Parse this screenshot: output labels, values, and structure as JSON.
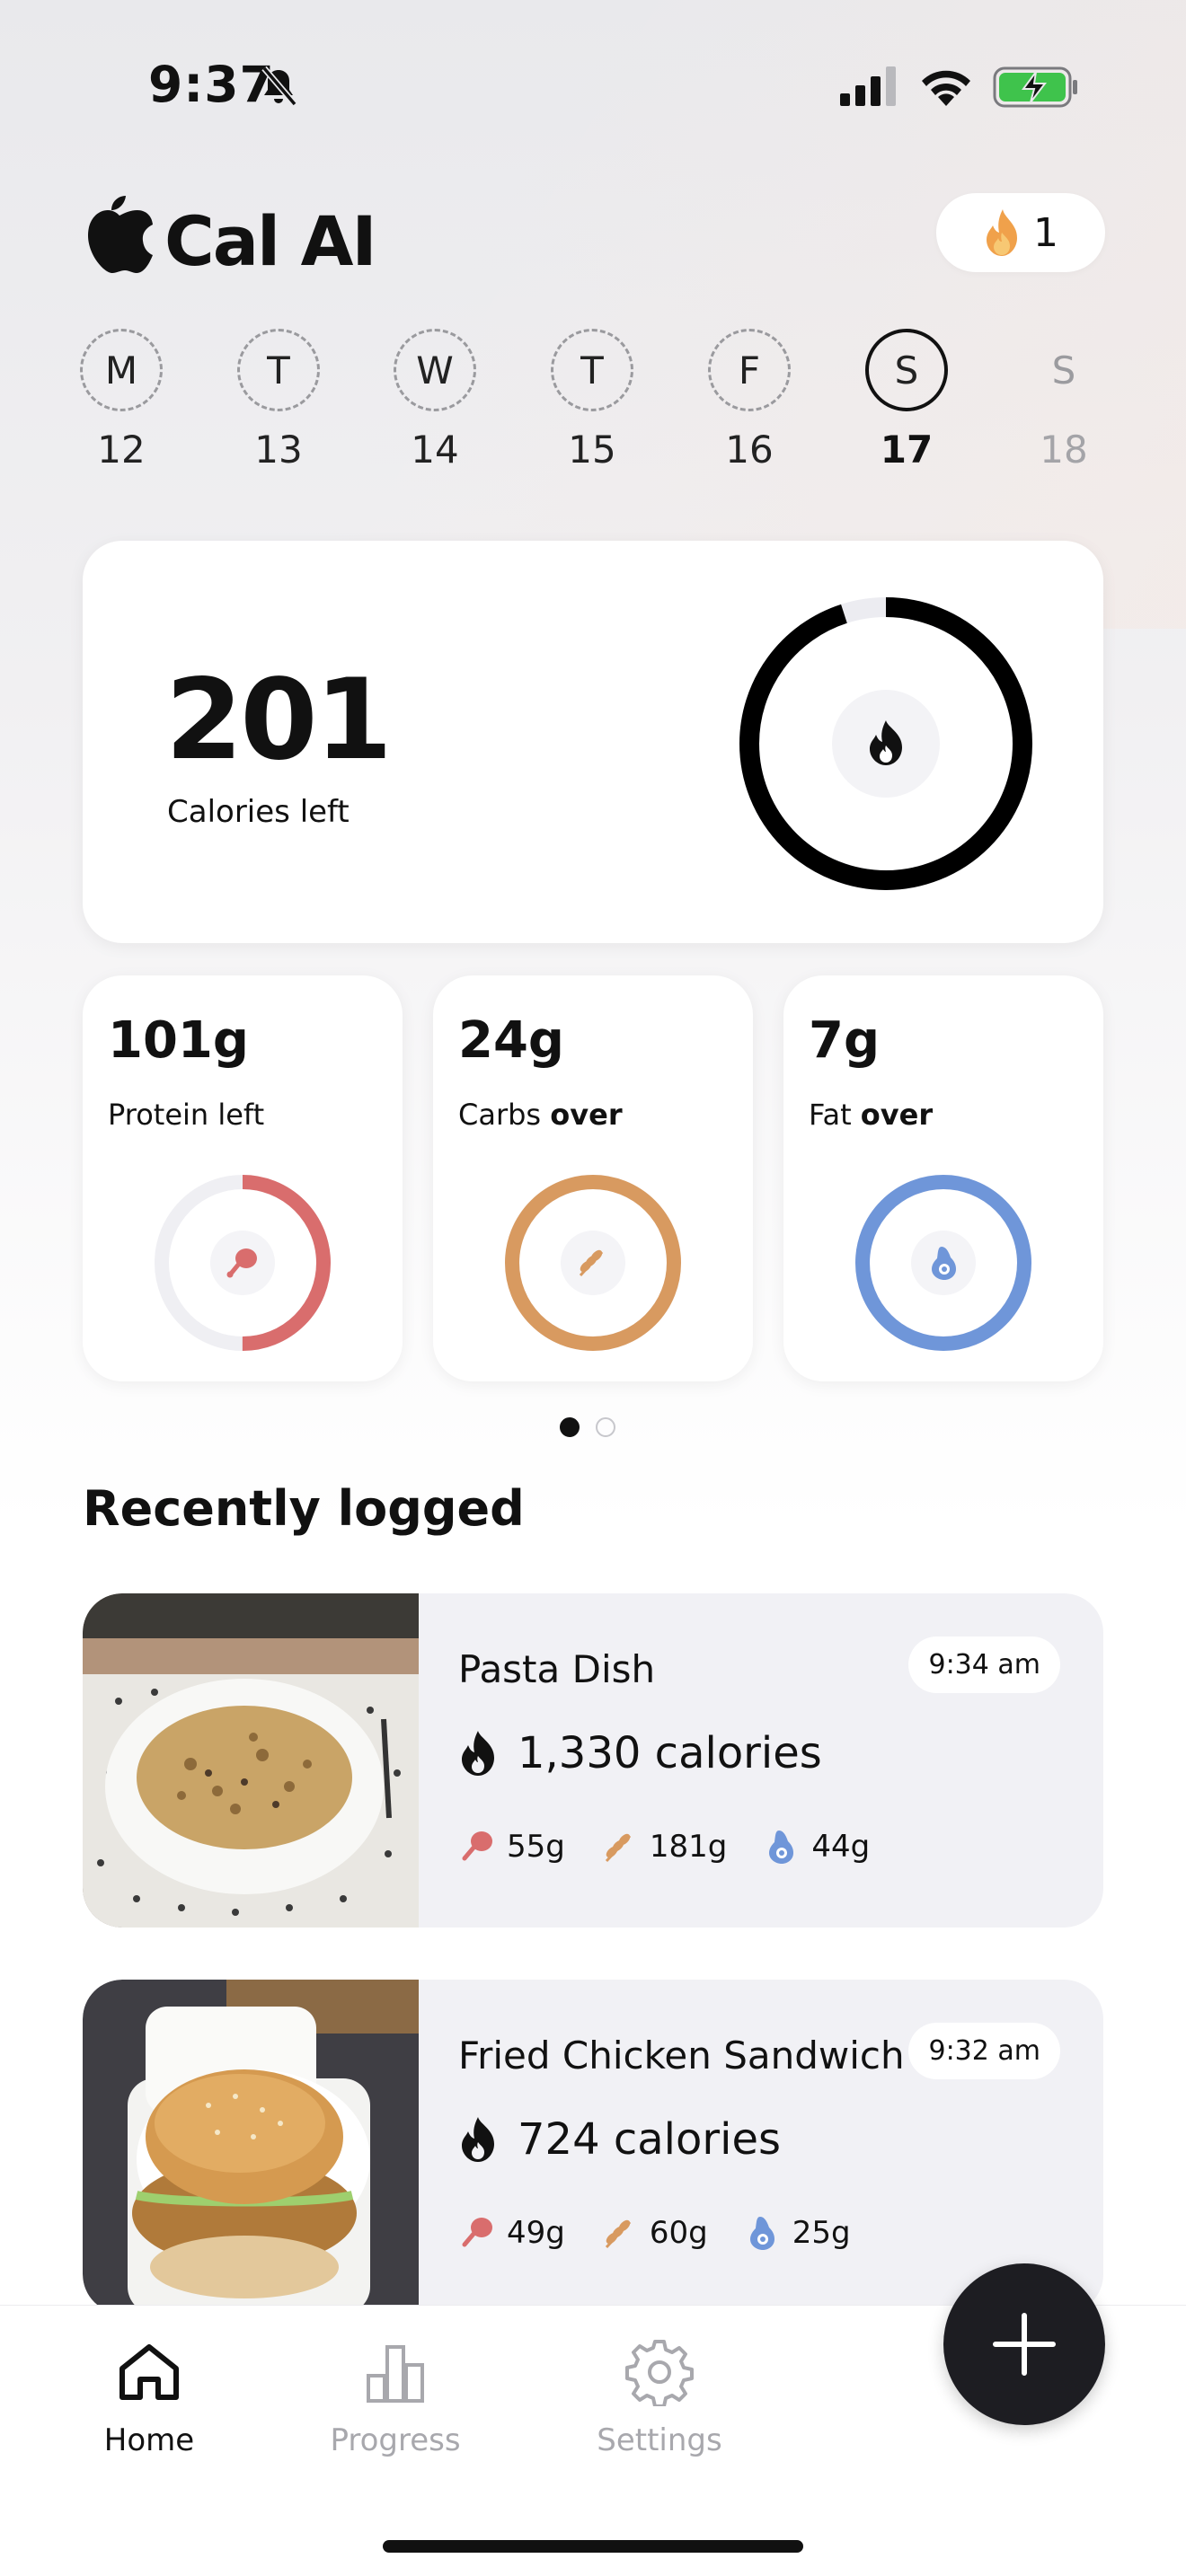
{
  "status_bar": {
    "time": "9:37"
  },
  "header": {
    "app_name": "Cal AI",
    "streak_count": "1"
  },
  "week": [
    {
      "letter": "M",
      "date": "12",
      "state": "past"
    },
    {
      "letter": "T",
      "date": "13",
      "state": "past"
    },
    {
      "letter": "W",
      "date": "14",
      "state": "past"
    },
    {
      "letter": "T",
      "date": "15",
      "state": "past"
    },
    {
      "letter": "F",
      "date": "16",
      "state": "past"
    },
    {
      "letter": "S",
      "date": "17",
      "state": "selected"
    },
    {
      "letter": "S",
      "date": "18",
      "state": "future"
    }
  ],
  "calories": {
    "value": "201",
    "label": "Calories left",
    "ring_progress": 0.95
  },
  "macros": [
    {
      "value": "101g",
      "label": "Protein",
      "suffix": "left",
      "color": "#d96d6d",
      "progress": 0.5
    },
    {
      "value": "24g",
      "label": "Carbs",
      "suffix": "over",
      "color": "#d89a60",
      "progress": 1.0
    },
    {
      "value": "7g",
      "label": "Fat",
      "suffix": "over",
      "color": "#6f96d9",
      "progress": 1.0
    }
  ],
  "pager": {
    "pages": 2,
    "current": 0
  },
  "recent": {
    "title": "Recently logged",
    "items": [
      {
        "name": "Pasta Dish",
        "time": "9:34 am",
        "calories": "1,330 calories",
        "protein": "55g",
        "carbs": "181g",
        "fat": "44g"
      },
      {
        "name": "Fried Chicken Sandwich",
        "time": "9:32 am",
        "calories": "724 calories",
        "protein": "49g",
        "carbs": "60g",
        "fat": "25g"
      }
    ]
  },
  "nav": {
    "home": "Home",
    "progress": "Progress",
    "settings": "Settings"
  },
  "colors": {
    "protein": "#d96d6d",
    "carbs": "#d89a60",
    "fat": "#6f96d9",
    "fab": "#1d1d22"
  }
}
